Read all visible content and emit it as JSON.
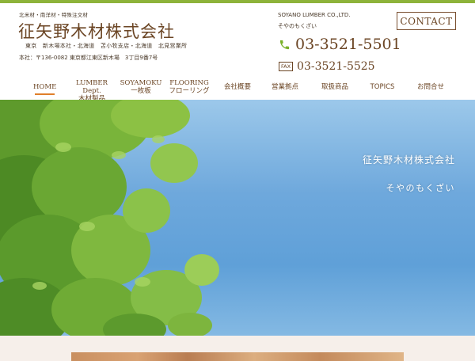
{
  "header": {
    "tagline": "北米材・南洋材・特殊注文材",
    "company_name": "征矢野木材株式会社",
    "branches": "東京　新木場本社・北海道　苫小牧支店・北海道　北見営業所",
    "address": "本社：〒136-0082 東京都江東区新木場　3丁目9番7号",
    "english_name": "SOYANO LUMBER CO.,LTD.",
    "kana_name": "そやのもくざい",
    "contact_label": "CONTACT",
    "phone": "03-3521-5501",
    "fax_label": "FAX",
    "fax": "03-3521-5525"
  },
  "nav": {
    "home": "HOME",
    "lumber_en": "LUMBER Dept.",
    "lumber_ja": "木材製品",
    "soyamoku_en": "SOYAMOKU",
    "soyamoku_ja": "一枚板",
    "flooring_en": "FLOORING",
    "flooring_ja": "フローリング",
    "company": "会社概要",
    "offices": "営業拠点",
    "products": "取扱商品",
    "topics": "TOPICS",
    "inquiry": "お問合せ"
  },
  "hero": {
    "title": "征矢野木材株式会社",
    "subtitle": "そやのもくざい"
  },
  "colors": {
    "accent_bar": "#8db33a",
    "brown_text": "#6b4524",
    "home_underline": "#e07f2a",
    "phone_icon": "#7ab02a"
  },
  "icons": {
    "phone": "phone-icon"
  }
}
